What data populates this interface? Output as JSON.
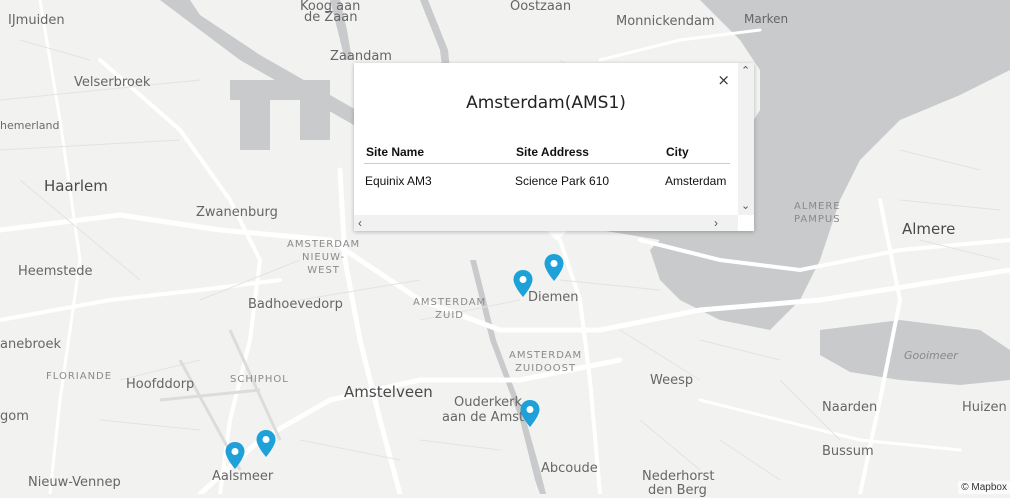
{
  "map": {
    "labels": {
      "ijmuiden": "IJmuiden",
      "velserbroek": "Velserbroek",
      "haarlemmerliede": "hemerland",
      "haarlem": "Haarlem",
      "heemstede": "Heemstede",
      "zwanenburg": "Zwanenburg",
      "badhoevedorp": "Badhoevedorp",
      "nieuw_vennep": "Nieuw-Vennep",
      "hoofddorp": "Hoofddorp",
      "floriande": "FLORIANDE",
      "schiphol": "SCHIPHOL",
      "aalsmeer": "Aalsmeer",
      "amstelveen": "Amstelveen",
      "ouderkerk1": "Ouderkerk",
      "ouderkerk2": "aan de Amstel",
      "abcoude": "Abcoude",
      "nederhorst1": "Nederhorst",
      "nederhorst2": "den Berg",
      "weesp": "Weesp",
      "diemen": "Diemen",
      "zaandam": "Zaandam",
      "koog": "Koog aan",
      "de_zaan": "de Zaan",
      "oostzaan": "Oostzaan",
      "monnickendam": "Monnickendam",
      "marken": "Marken",
      "almere": "Almere",
      "almere_pampus1": "ALMERE",
      "almere_pampus2": "PAMPUS",
      "gooimeer": "Gooimeer",
      "naarden": "Naarden",
      "huizen": "Huizen",
      "bussum": "Bussum",
      "nieuw_west1": "AMSTERDAM",
      "nieuw_west2": "NIEUW-",
      "nieuw_west3": "WEST",
      "zuid1": "AMSTERDAM",
      "zuid2": "ZUID",
      "zuidoost1": "AMSTERDAM",
      "zuidoost2": "ZUIDOOST",
      "anebroek": "anebroek",
      "hoofddorp_west": "gom"
    },
    "attribution": "© Mapbox",
    "marker_color": "#1ea1d9",
    "water_color": "#c8cacb",
    "land_color": "#f2f2f1"
  },
  "popup": {
    "close_label": "×",
    "title": "Amsterdam(AMS1)",
    "columns": [
      "Site Name",
      "Site Address",
      "City"
    ],
    "rows": [
      {
        "site_name": "Equinix AM3",
        "site_address": "Science Park 610",
        "city": "Amsterdam"
      }
    ]
  }
}
